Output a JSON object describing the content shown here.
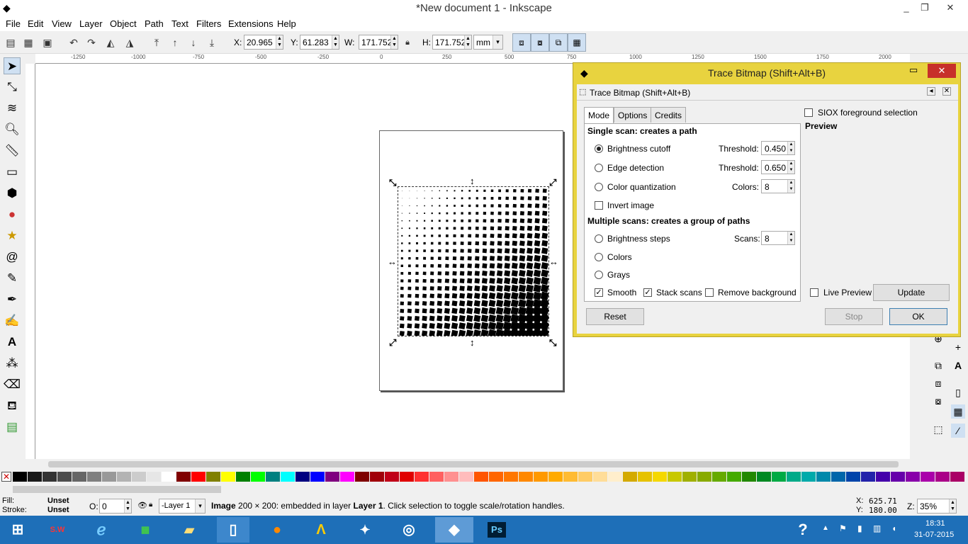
{
  "window": {
    "title": "*New document 1 - Inkscape",
    "min": "_",
    "max": "❐",
    "close": "✕"
  },
  "menu": [
    "File",
    "Edit",
    "View",
    "Layer",
    "Object",
    "Path",
    "Text",
    "Filters",
    "Extensions",
    "Help"
  ],
  "toolbar": {
    "x_label": "X:",
    "x": "20.965",
    "y_label": "Y:",
    "y": "61.283",
    "w_label": "W:",
    "w": "171.752",
    "h_label": "H:",
    "h": "171.752",
    "unit": "mm"
  },
  "ruler": {
    "h_ticks": [
      "-1250",
      "-1000",
      "-750",
      "-500",
      "-250",
      "0",
      "250",
      "500",
      "750",
      "1000",
      "1250",
      "1500",
      "1750",
      "2000"
    ]
  },
  "dialog": {
    "title": "Trace Bitmap (Shift+Alt+B)",
    "panel_title": "Trace Bitmap (Shift+Alt+B)",
    "tabs": [
      "Mode",
      "Options",
      "Credits"
    ],
    "single_scan_heading": "Single scan: creates a path",
    "brightness_cutoff": "Brightness cutoff",
    "edge_detection": "Edge detection",
    "color_quantization": "Color quantization",
    "invert_image": "Invert image",
    "threshold_label": "Threshold:",
    "threshold1": "0.450",
    "threshold2": "0.650",
    "colors_label": "Colors:",
    "colors_value": "8",
    "multiple_scan_heading": "Multiple scans: creates a group of paths",
    "brightness_steps": "Brightness steps",
    "scans_label": "Scans:",
    "scans_value": "8",
    "colors_opt": "Colors",
    "grays_opt": "Grays",
    "smooth": "Smooth",
    "stack_scans": "Stack scans",
    "remove_background": "Remove background",
    "siox": "SIOX foreground selection",
    "preview": "Preview",
    "live_preview": "Live Preview",
    "update": "Update",
    "reset": "Reset",
    "stop": "Stop",
    "ok": "OK"
  },
  "palette_colors": [
    "#000000",
    "#1a1a1a",
    "#333333",
    "#4d4d4d",
    "#666666",
    "#808080",
    "#999999",
    "#b3b3b3",
    "#cccccc",
    "#e6e6e6",
    "#ffffff",
    "#800000",
    "#ff0000",
    "#808000",
    "#ffff00",
    "#008000",
    "#00ff00",
    "#008080",
    "#00ffff",
    "#000080",
    "#0000ff",
    "#800080",
    "#ff00ff",
    "#7f0000",
    "#a0000a",
    "#c00018",
    "#e00000",
    "#ff3030",
    "#ff6060",
    "#ff9090",
    "#ffbcbc",
    "#ff5500",
    "#ff6600",
    "#ff7700",
    "#ff8800",
    "#ff9900",
    "#ffaa00",
    "#ffbb33",
    "#ffcc66",
    "#ffdd99",
    "#ffeecc",
    "#d4aa00",
    "#e6c200",
    "#f5d800",
    "#c8c800",
    "#a0b000",
    "#88aa00",
    "#66aa00",
    "#44aa00",
    "#228800",
    "#008822",
    "#00aa44",
    "#00aa88",
    "#00aaaa",
    "#0088aa",
    "#0066aa",
    "#0044aa",
    "#2222aa",
    "#4400aa",
    "#6600aa",
    "#8800aa",
    "#aa00aa",
    "#aa0088",
    "#aa0066"
  ],
  "status": {
    "fill_label": "Fill:",
    "fill_value": "Unset",
    "stroke_label": "Stroke:",
    "stroke_value": "Unset",
    "opacity_label": "O:",
    "opacity_value": "0",
    "layer": "-Layer 1",
    "msg_bold": "Image",
    "msg": " 200 × 200: embedded in layer ",
    "msg_layer": "Layer 1",
    "msg_tail": ". Click selection to toggle scale/rotation handles.",
    "cx_label": "X:",
    "cx": "625.71",
    "cy_label": "Y:",
    "cy": "180.00",
    "zoom_label": "Z:",
    "zoom": "35%"
  },
  "taskbar": {
    "time": "18:31",
    "date": "31-07-2015"
  },
  "icons": {
    "brand": "inkscape-logo",
    "ps": "Ps"
  }
}
